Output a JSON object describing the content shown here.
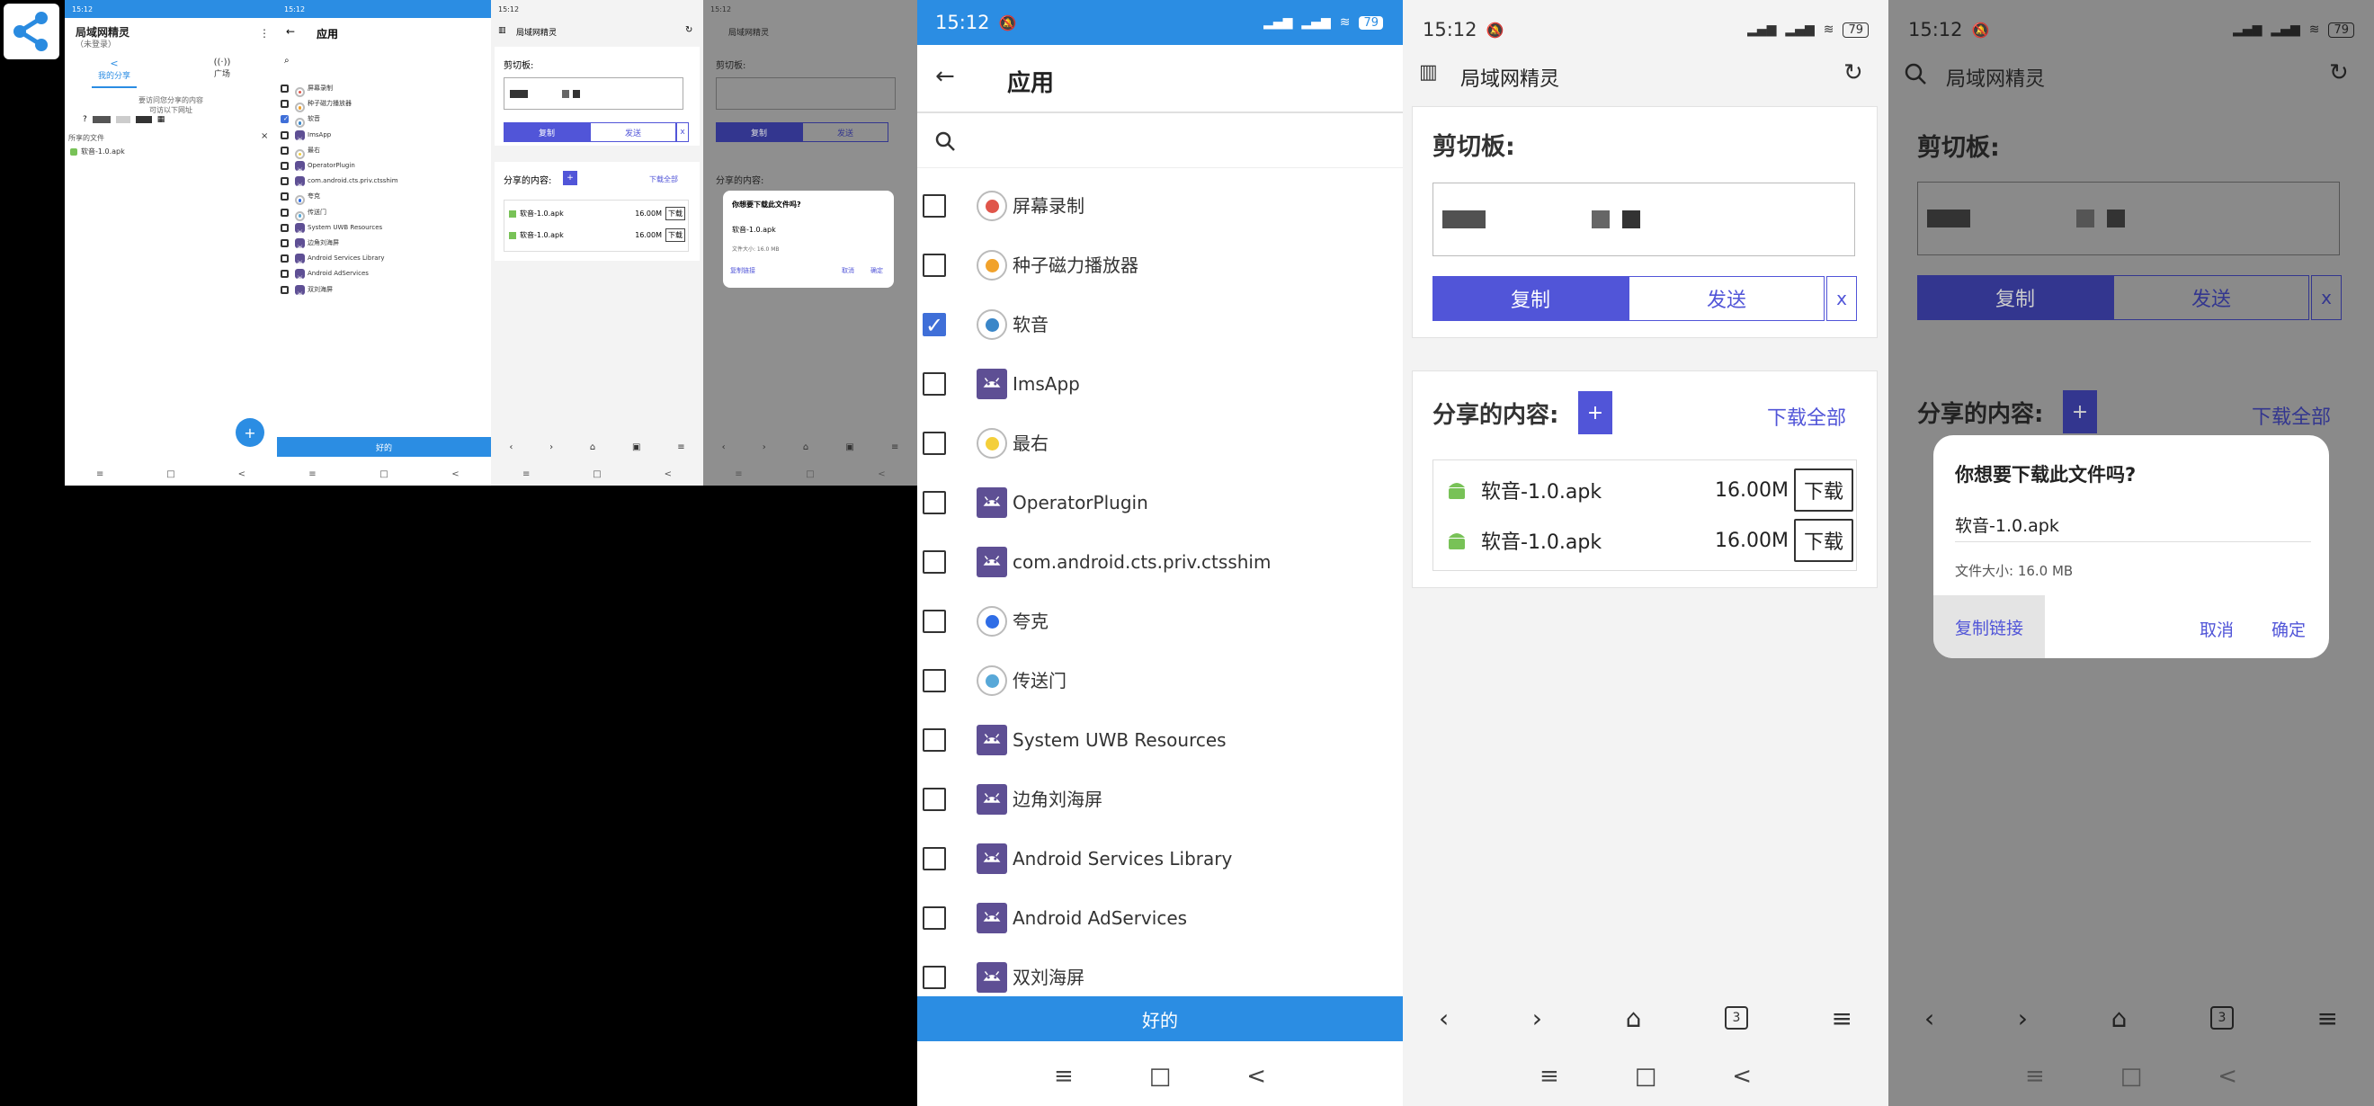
{
  "status": {
    "time": "15:12",
    "battery": "79",
    "mini_time": "15:12"
  },
  "app_icon": "share-icon",
  "home": {
    "title": "局域网精灵",
    "subtitle": "（未登录）",
    "tab_myshare": "我的分享",
    "tab_square": "广场",
    "hint1": "要访问您分享的内容",
    "hint2": "可访以下网址",
    "files_label": "所享的文件",
    "file": "软音-1.0.apk",
    "fab": "+"
  },
  "apps": {
    "title": "应用",
    "ok": "好的",
    "items": [
      {
        "name": "屏幕录制",
        "checked": false,
        "icon": "recorder"
      },
      {
        "name": "种子磁力播放器",
        "checked": false,
        "icon": "player"
      },
      {
        "name": "软音",
        "checked": true,
        "icon": "ruanyin"
      },
      {
        "name": "ImsApp",
        "checked": false,
        "icon": "android"
      },
      {
        "name": "最右",
        "checked": false,
        "icon": "zuiyou"
      },
      {
        "name": "OperatorPlugin",
        "checked": false,
        "icon": "android"
      },
      {
        "name": "com.android.cts.priv.ctsshim",
        "checked": false,
        "icon": "android"
      },
      {
        "name": "夸克",
        "checked": false,
        "icon": "quark"
      },
      {
        "name": "传送门",
        "checked": false,
        "icon": "portal"
      },
      {
        "name": "System UWB Resources",
        "checked": false,
        "icon": "android"
      },
      {
        "name": "边角刘海屏",
        "checked": false,
        "icon": "android"
      },
      {
        "name": "Android Services Library",
        "checked": false,
        "icon": "android"
      },
      {
        "name": "Android AdServices",
        "checked": false,
        "icon": "android"
      },
      {
        "name": "双刘海屏",
        "checked": false,
        "icon": "android"
      }
    ]
  },
  "browser": {
    "title": "局域网精灵",
    "clipboard_label": "剪切板:",
    "copy": "复制",
    "send": "发送",
    "close": "x",
    "shared_label": "分享的内容:",
    "add": "+",
    "download_all": "下载全部",
    "files": [
      {
        "name": "软音-1.0.apk",
        "size": "16.00M",
        "action": "下载"
      },
      {
        "name": "软音-1.0.apk",
        "size": "16.00M",
        "action": "下载"
      }
    ],
    "tab_count": "3"
  },
  "dialog": {
    "title": "你想要下载此文件吗?",
    "filename": "软音-1.0.apk",
    "size": "文件大小: 16.0 MB",
    "copy_link": "复制链接",
    "cancel": "取消",
    "confirm": "确定"
  },
  "colors": {
    "accent": "#5155d8",
    "blue": "#3f9ae6",
    "dim": "#8a8a8a"
  }
}
